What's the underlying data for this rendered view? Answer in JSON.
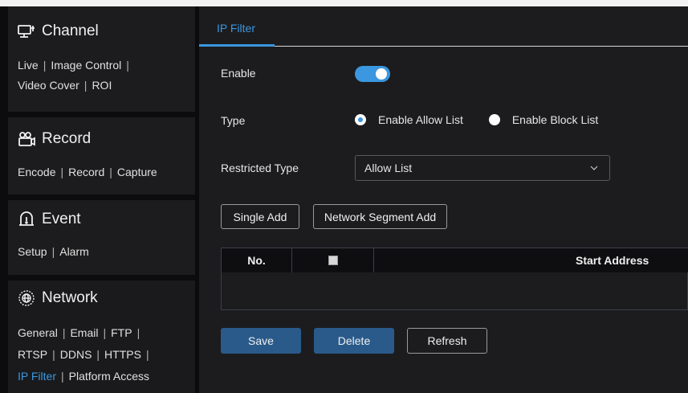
{
  "sidebar": {
    "channel": {
      "title": "Channel",
      "icon": "monitor-icon",
      "links": [
        "Live",
        "Image Control",
        "Video Cover",
        "ROI"
      ]
    },
    "record": {
      "title": "Record",
      "icon": "video-camera-icon",
      "links": [
        "Encode",
        "Record",
        "Capture"
      ]
    },
    "event": {
      "title": "Event",
      "icon": "alarm-icon",
      "links": [
        "Setup",
        "Alarm"
      ]
    },
    "network": {
      "title": "Network",
      "icon": "globe-icon",
      "links": [
        "General",
        "Email",
        "FTP",
        "RTSP",
        "DDNS",
        "HTTPS",
        "IP Filter",
        "Platform Access"
      ],
      "current": "IP Filter"
    }
  },
  "main": {
    "tab": "IP Filter",
    "enable_label": "Enable",
    "enable_on": true,
    "type_label": "Type",
    "type_options": [
      "Enable Allow List",
      "Enable Block List"
    ],
    "type_selected": "Enable Allow List",
    "restricted_label": "Restricted Type",
    "restricted_value": "Allow List",
    "single_add": "Single Add",
    "segment_add": "Network Segment Add",
    "table": {
      "columns": [
        "No.",
        "",
        "Start Address"
      ],
      "rows": []
    },
    "save": "Save",
    "delete": "Delete",
    "refresh": "Refresh"
  },
  "colors": {
    "accent": "#3a97e0",
    "primary_button": "#2a5a8a",
    "panel": "#1c1c1e"
  }
}
